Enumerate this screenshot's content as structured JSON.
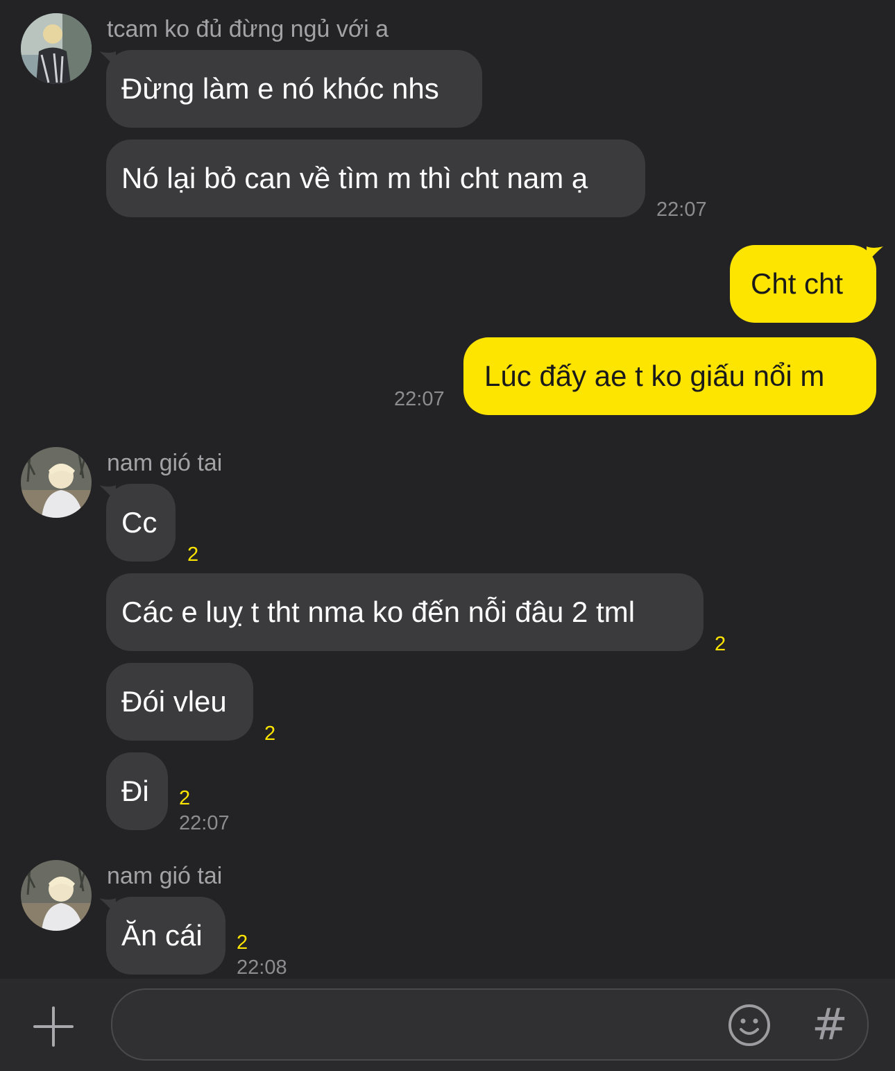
{
  "chat": {
    "groups": [
      {
        "sender": "tcam ko đủ đừng ngủ với a",
        "messages": [
          {
            "text": "Đừng làm e nó khóc nhs",
            "unread": "",
            "time": ""
          },
          {
            "text": "Nó lại bỏ can về tìm m thì cht nam ạ",
            "unread": "",
            "time": "22:07"
          }
        ]
      },
      {
        "sender": "me",
        "messages": [
          {
            "text": "Cht cht",
            "time": ""
          },
          {
            "text": "Lúc đấy ae t ko giấu nổi m",
            "time": "22:07"
          }
        ]
      },
      {
        "sender": "nam gió tai",
        "messages": [
          {
            "text": "Cc",
            "unread": "2",
            "time": ""
          },
          {
            "text": "Các e luỵ t tht nma ko đến nỗi đâu 2 tml",
            "unread": "2",
            "time": ""
          },
          {
            "text": "Đói vleu",
            "unread": "2",
            "time": ""
          },
          {
            "text": "Đi",
            "unread": "2",
            "time": "22:07"
          }
        ]
      },
      {
        "sender": "nam gió tai",
        "messages": [
          {
            "text": "Ăn cái",
            "unread": "2",
            "time": "22:08"
          }
        ]
      }
    ]
  },
  "input_bar": {
    "plus_icon": "plus-icon",
    "emoji_icon": "emoji-icon",
    "hash_label": "#",
    "placeholder": ""
  },
  "colors": {
    "background": "#232325",
    "incoming_bubble": "#3b3b3e",
    "outgoing_bubble": "#fee500",
    "unread_count": "#fee500",
    "timestamp": "#8d8d91"
  }
}
